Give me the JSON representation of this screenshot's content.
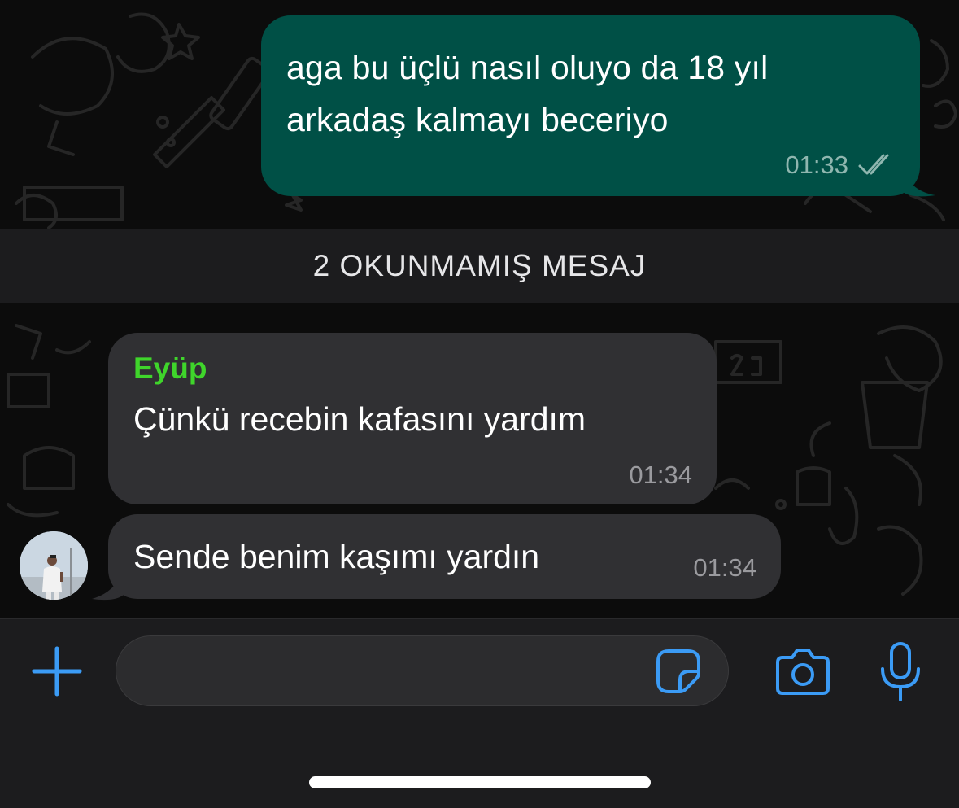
{
  "chat": {
    "outgoing": {
      "text": "aga bu üçlü nasıl oluyo da 18 yıl arkadaş kalmayı beceriyo",
      "time": "01:33",
      "status_icon": "double-check-icon"
    },
    "unread_banner": "2 OKUNMAMIŞ MESAJ",
    "incoming": [
      {
        "sender": "Eyüp",
        "text": "Çünkü recebin kafasını yardım",
        "time": "01:34"
      },
      {
        "text": "Sende benim kaşımı yardın",
        "time": "01:34"
      }
    ]
  },
  "composer": {
    "plus_icon": "plus-icon",
    "sticker_icon": "sticker-icon",
    "camera_icon": "camera-icon",
    "mic_icon": "microphone-icon"
  },
  "colors": {
    "accent": "#3b9bf5",
    "outgoing_bubble": "#005046",
    "incoming_bubble": "#303033",
    "sender_name": "#3fd52b"
  }
}
